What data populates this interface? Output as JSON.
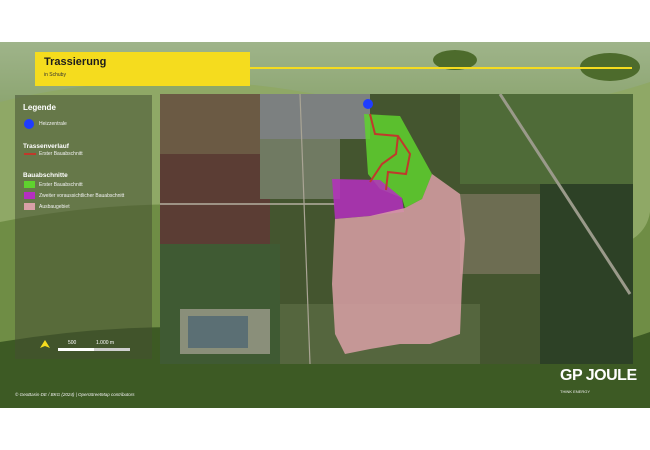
{
  "header": {
    "title": "Trassierung",
    "subtitle": "in Schuby"
  },
  "legend": {
    "title": "Legende",
    "heating": {
      "label": "Heizzentrale",
      "color": "#1f3cff"
    },
    "route": {
      "heading": "Trassenverlauf",
      "items": [
        {
          "label": "Erster Bauabschnitt",
          "color": "#c0392b"
        }
      ]
    },
    "phases": {
      "heading": "Bauabschnitte",
      "items": [
        {
          "label": "Erster Bauabschnitt",
          "color": "#5fd22e"
        },
        {
          "label": "Zweiter voraussichtlicher Bauabschnitt",
          "color": "#b52fbf"
        },
        {
          "label": "Ausbaugebiet",
          "color": "#d9a0a6"
        }
      ]
    }
  },
  "scale_bar": {
    "labels": [
      "500",
      "1.000 m"
    ]
  },
  "attribution": "© GeoBasis-DE / BKG (2024) | OpenStreetMap contributors",
  "logo": {
    "text": "GP JOULE",
    "tagline": "THINK ENERGY"
  }
}
